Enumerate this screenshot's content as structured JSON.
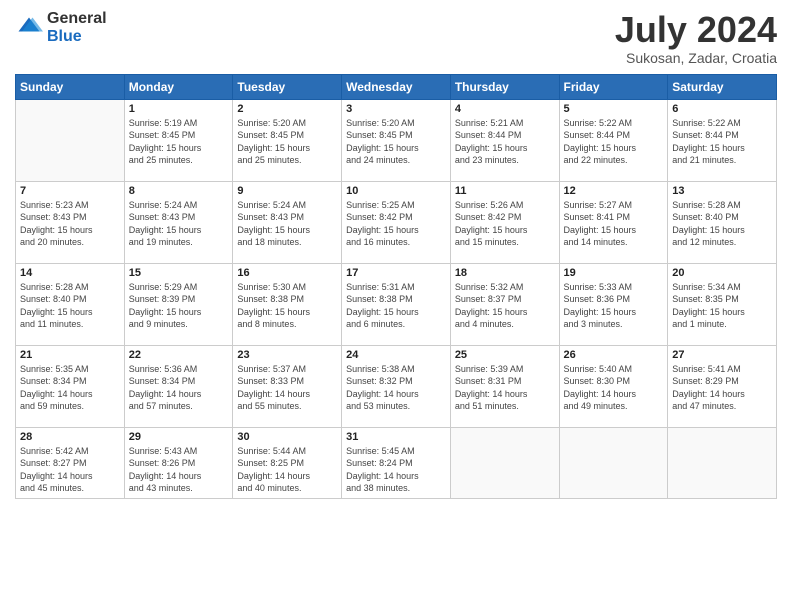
{
  "header": {
    "logo_general": "General",
    "logo_blue": "Blue",
    "month_year": "July 2024",
    "location": "Sukosan, Zadar, Croatia"
  },
  "weekdays": [
    "Sunday",
    "Monday",
    "Tuesday",
    "Wednesday",
    "Thursday",
    "Friday",
    "Saturday"
  ],
  "weeks": [
    [
      {
        "day": "",
        "info": ""
      },
      {
        "day": "1",
        "info": "Sunrise: 5:19 AM\nSunset: 8:45 PM\nDaylight: 15 hours\nand 25 minutes."
      },
      {
        "day": "2",
        "info": "Sunrise: 5:20 AM\nSunset: 8:45 PM\nDaylight: 15 hours\nand 25 minutes."
      },
      {
        "day": "3",
        "info": "Sunrise: 5:20 AM\nSunset: 8:45 PM\nDaylight: 15 hours\nand 24 minutes."
      },
      {
        "day": "4",
        "info": "Sunrise: 5:21 AM\nSunset: 8:44 PM\nDaylight: 15 hours\nand 23 minutes."
      },
      {
        "day": "5",
        "info": "Sunrise: 5:22 AM\nSunset: 8:44 PM\nDaylight: 15 hours\nand 22 minutes."
      },
      {
        "day": "6",
        "info": "Sunrise: 5:22 AM\nSunset: 8:44 PM\nDaylight: 15 hours\nand 21 minutes."
      }
    ],
    [
      {
        "day": "7",
        "info": "Sunrise: 5:23 AM\nSunset: 8:43 PM\nDaylight: 15 hours\nand 20 minutes."
      },
      {
        "day": "8",
        "info": "Sunrise: 5:24 AM\nSunset: 8:43 PM\nDaylight: 15 hours\nand 19 minutes."
      },
      {
        "day": "9",
        "info": "Sunrise: 5:24 AM\nSunset: 8:43 PM\nDaylight: 15 hours\nand 18 minutes."
      },
      {
        "day": "10",
        "info": "Sunrise: 5:25 AM\nSunset: 8:42 PM\nDaylight: 15 hours\nand 16 minutes."
      },
      {
        "day": "11",
        "info": "Sunrise: 5:26 AM\nSunset: 8:42 PM\nDaylight: 15 hours\nand 15 minutes."
      },
      {
        "day": "12",
        "info": "Sunrise: 5:27 AM\nSunset: 8:41 PM\nDaylight: 15 hours\nand 14 minutes."
      },
      {
        "day": "13",
        "info": "Sunrise: 5:28 AM\nSunset: 8:40 PM\nDaylight: 15 hours\nand 12 minutes."
      }
    ],
    [
      {
        "day": "14",
        "info": "Sunrise: 5:28 AM\nSunset: 8:40 PM\nDaylight: 15 hours\nand 11 minutes."
      },
      {
        "day": "15",
        "info": "Sunrise: 5:29 AM\nSunset: 8:39 PM\nDaylight: 15 hours\nand 9 minutes."
      },
      {
        "day": "16",
        "info": "Sunrise: 5:30 AM\nSunset: 8:38 PM\nDaylight: 15 hours\nand 8 minutes."
      },
      {
        "day": "17",
        "info": "Sunrise: 5:31 AM\nSunset: 8:38 PM\nDaylight: 15 hours\nand 6 minutes."
      },
      {
        "day": "18",
        "info": "Sunrise: 5:32 AM\nSunset: 8:37 PM\nDaylight: 15 hours\nand 4 minutes."
      },
      {
        "day": "19",
        "info": "Sunrise: 5:33 AM\nSunset: 8:36 PM\nDaylight: 15 hours\nand 3 minutes."
      },
      {
        "day": "20",
        "info": "Sunrise: 5:34 AM\nSunset: 8:35 PM\nDaylight: 15 hours\nand 1 minute."
      }
    ],
    [
      {
        "day": "21",
        "info": "Sunrise: 5:35 AM\nSunset: 8:34 PM\nDaylight: 14 hours\nand 59 minutes."
      },
      {
        "day": "22",
        "info": "Sunrise: 5:36 AM\nSunset: 8:34 PM\nDaylight: 14 hours\nand 57 minutes."
      },
      {
        "day": "23",
        "info": "Sunrise: 5:37 AM\nSunset: 8:33 PM\nDaylight: 14 hours\nand 55 minutes."
      },
      {
        "day": "24",
        "info": "Sunrise: 5:38 AM\nSunset: 8:32 PM\nDaylight: 14 hours\nand 53 minutes."
      },
      {
        "day": "25",
        "info": "Sunrise: 5:39 AM\nSunset: 8:31 PM\nDaylight: 14 hours\nand 51 minutes."
      },
      {
        "day": "26",
        "info": "Sunrise: 5:40 AM\nSunset: 8:30 PM\nDaylight: 14 hours\nand 49 minutes."
      },
      {
        "day": "27",
        "info": "Sunrise: 5:41 AM\nSunset: 8:29 PM\nDaylight: 14 hours\nand 47 minutes."
      }
    ],
    [
      {
        "day": "28",
        "info": "Sunrise: 5:42 AM\nSunset: 8:27 PM\nDaylight: 14 hours\nand 45 minutes."
      },
      {
        "day": "29",
        "info": "Sunrise: 5:43 AM\nSunset: 8:26 PM\nDaylight: 14 hours\nand 43 minutes."
      },
      {
        "day": "30",
        "info": "Sunrise: 5:44 AM\nSunset: 8:25 PM\nDaylight: 14 hours\nand 40 minutes."
      },
      {
        "day": "31",
        "info": "Sunrise: 5:45 AM\nSunset: 8:24 PM\nDaylight: 14 hours\nand 38 minutes."
      },
      {
        "day": "",
        "info": ""
      },
      {
        "day": "",
        "info": ""
      },
      {
        "day": "",
        "info": ""
      }
    ]
  ]
}
